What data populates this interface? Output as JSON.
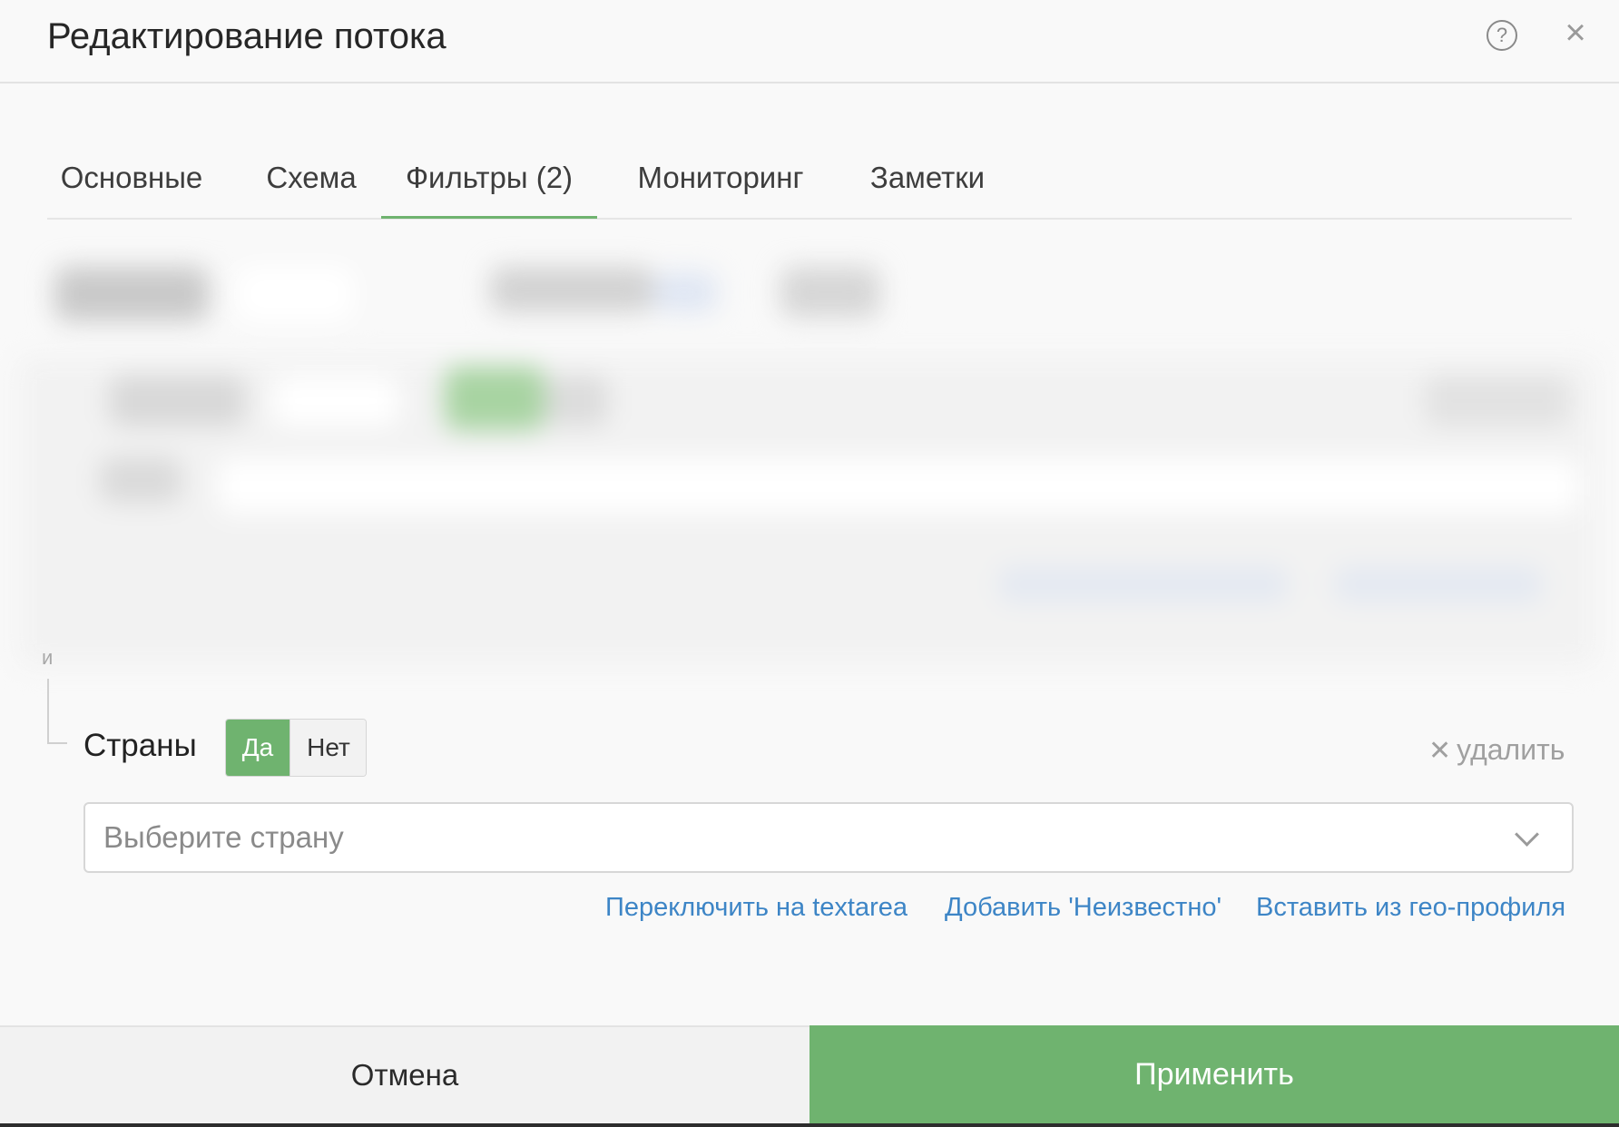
{
  "header": {
    "title": "Редактирование потока",
    "help_glyph": "?",
    "close_glyph": "×"
  },
  "tabs": [
    {
      "label": "Основные",
      "active": false
    },
    {
      "label": "Схема",
      "active": false
    },
    {
      "label": "Фильтры (2)",
      "active": true
    },
    {
      "label": "Мониторинг",
      "active": false
    },
    {
      "label": "Заметки",
      "active": false
    }
  ],
  "filter": {
    "connector": "и",
    "label": "Страны",
    "toggle_yes": "Да",
    "toggle_no": "Нет",
    "toggle_selected": "Да",
    "remove_glyph": "✕",
    "remove_label": "удалить",
    "select_placeholder": "Выберите страну",
    "actions": [
      "Переключить на textarea",
      "Добавить 'Неизвестно'",
      "Вставить из гео-профиля"
    ]
  },
  "footer": {
    "cancel": "Отмена",
    "apply": "Применить"
  },
  "colors": {
    "accent_green": "#6fb36f",
    "link_blue": "#3d85c6"
  },
  "icons": {
    "help": "help-icon",
    "close": "close-icon",
    "chevron": "chevron-down-icon"
  }
}
